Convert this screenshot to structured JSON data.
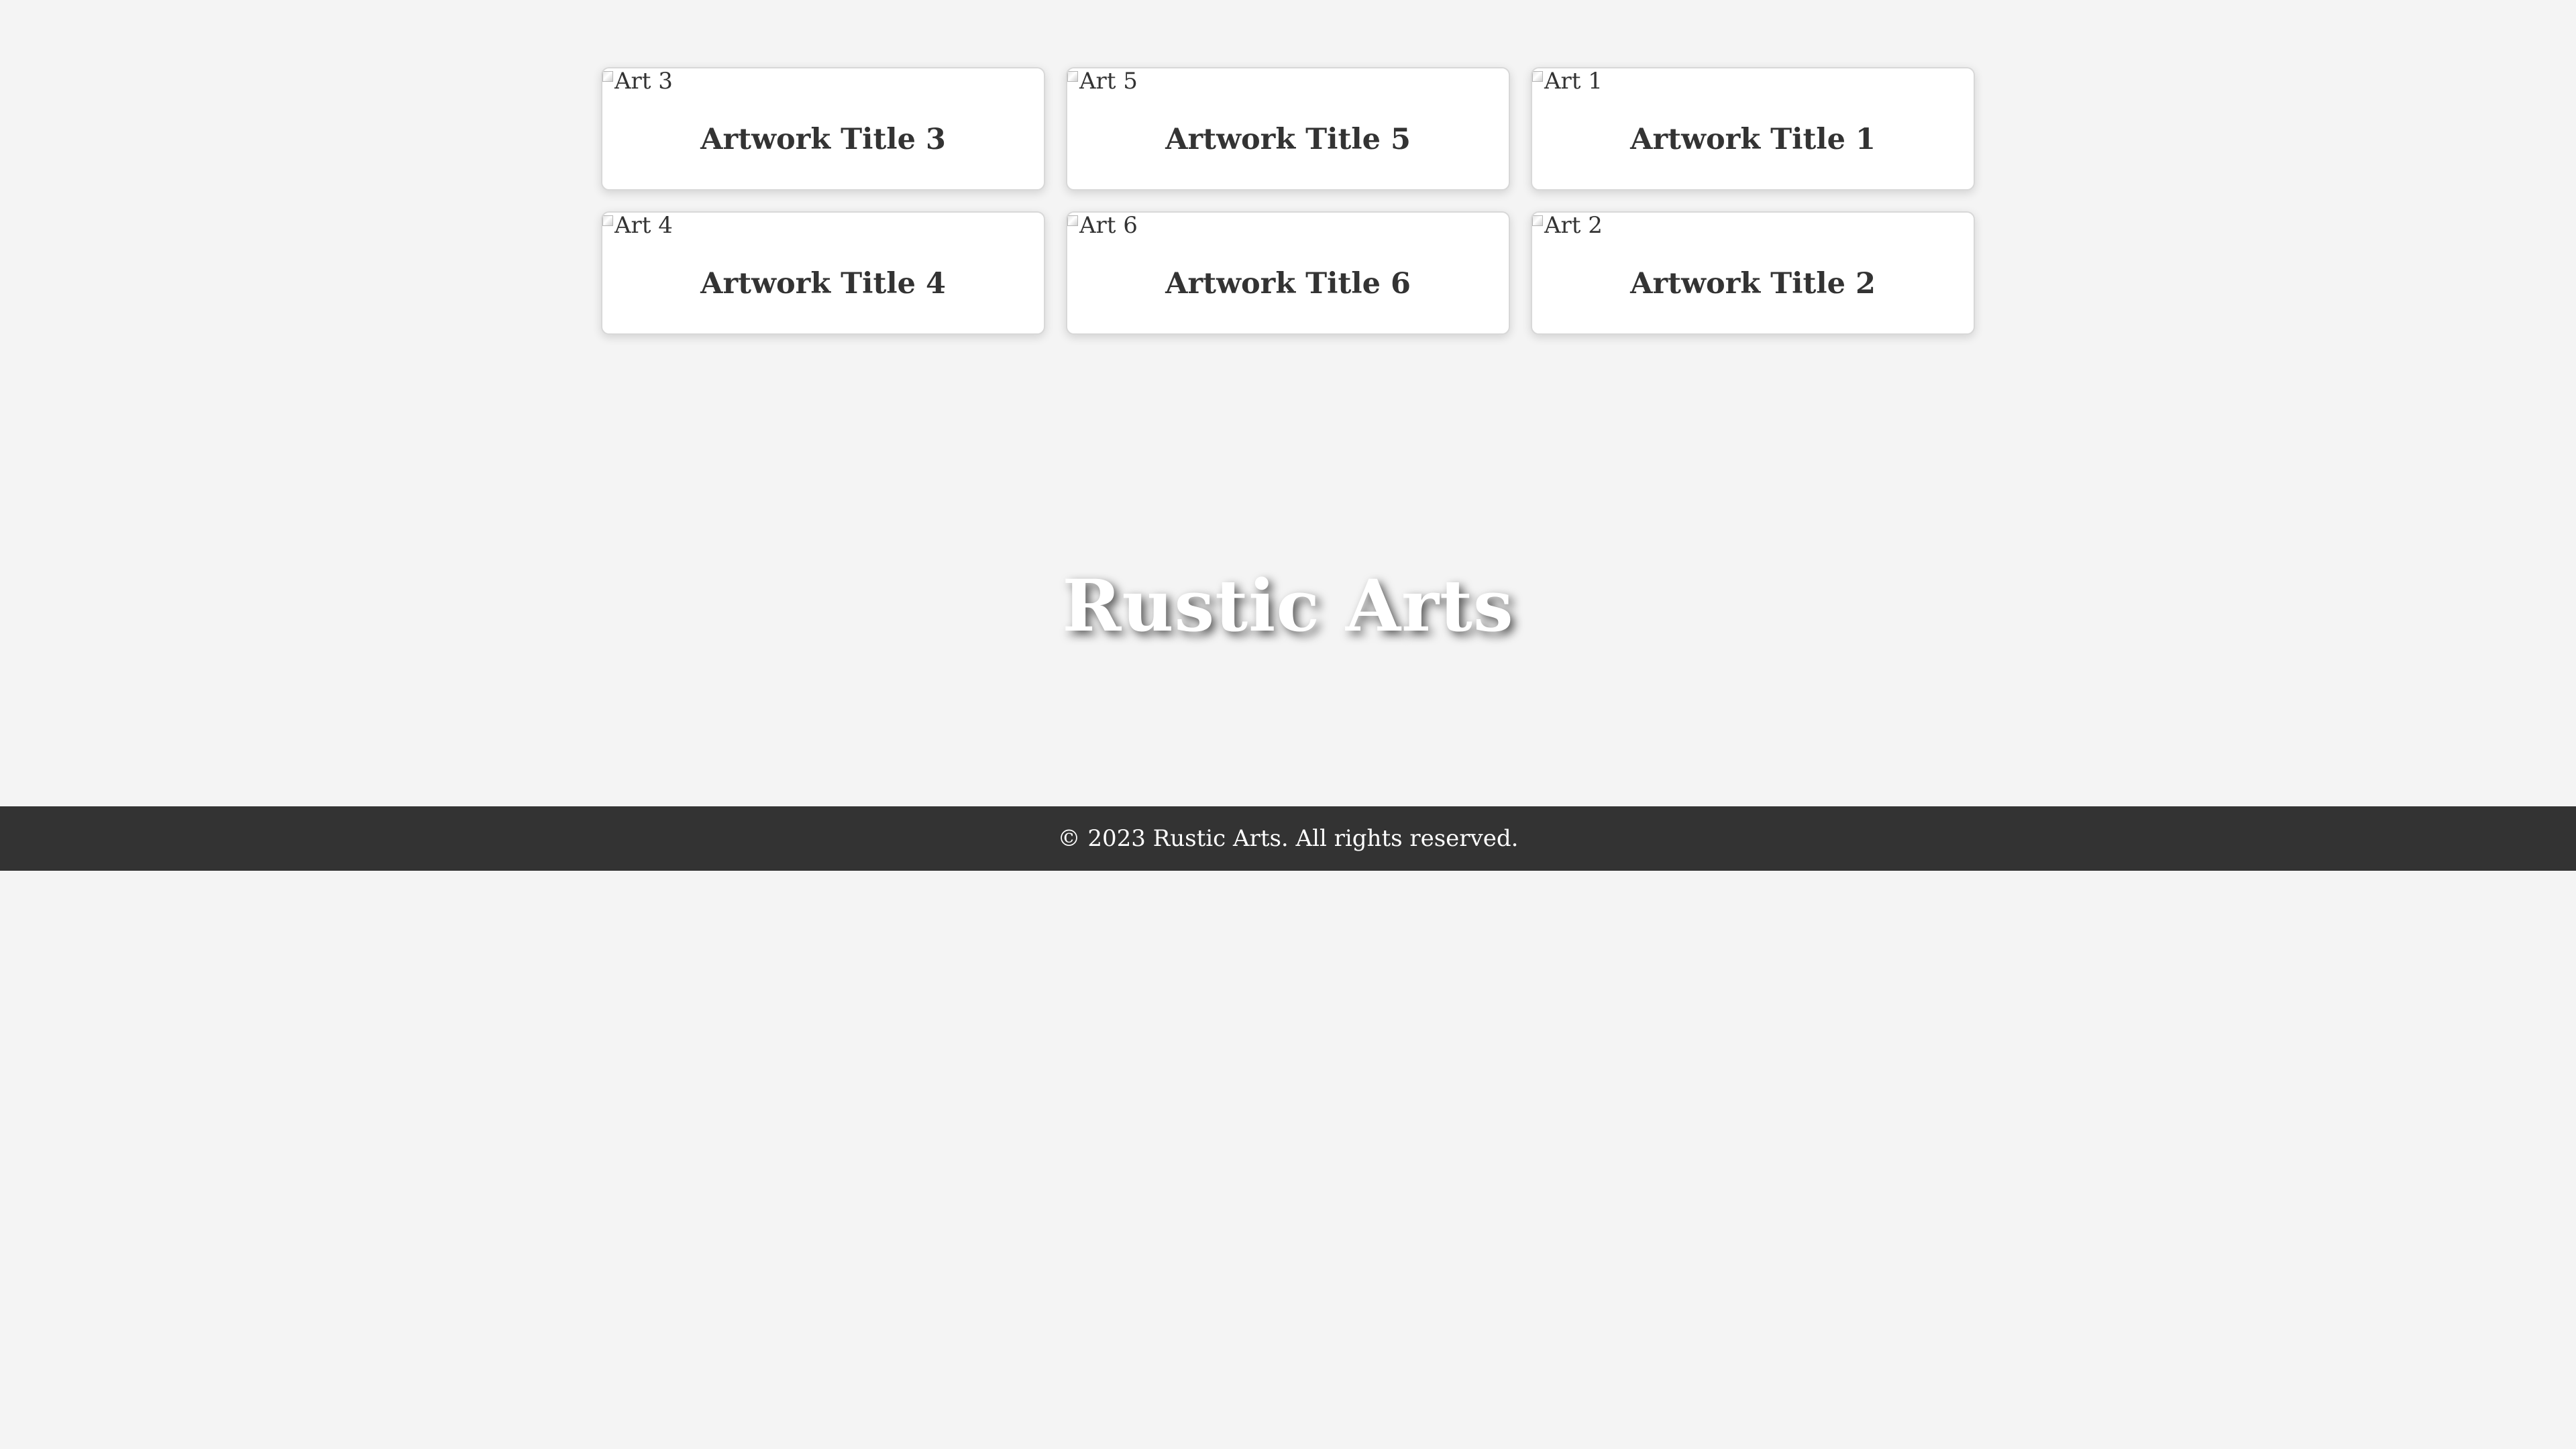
{
  "gallery": {
    "cards": [
      {
        "image_alt": "Art 3",
        "title": "Artwork Title 3"
      },
      {
        "image_alt": "Art 5",
        "title": "Artwork Title 5"
      },
      {
        "image_alt": "Art 1",
        "title": "Artwork Title 1"
      },
      {
        "image_alt": "Art 4",
        "title": "Artwork Title 4"
      },
      {
        "image_alt": "Art 6",
        "title": "Artwork Title 6"
      },
      {
        "image_alt": "Art 2",
        "title": "Artwork Title 2"
      }
    ]
  },
  "hero": {
    "title": "Rustic Arts"
  },
  "footer": {
    "text": "© 2023 Rustic Arts. All rights reserved."
  },
  "colors": {
    "page_background": "#f4f4f4",
    "card_background": "#ffffff",
    "text": "#333333",
    "footer_background": "#333333",
    "footer_text": "#ffffff",
    "hero_text": "#ffffff"
  }
}
